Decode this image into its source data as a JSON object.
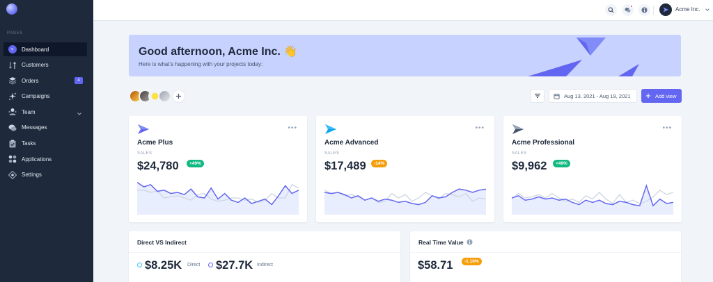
{
  "sidebar": {
    "section_label": "Pages",
    "items": [
      {
        "label": "Dashboard",
        "icon": "dashboard-icon",
        "active": true
      },
      {
        "label": "Customers",
        "icon": "customers-icon"
      },
      {
        "label": "Orders",
        "icon": "orders-icon",
        "badge": "4"
      },
      {
        "label": "Campaigns",
        "icon": "campaigns-icon"
      },
      {
        "label": "Team",
        "icon": "team-icon",
        "expandable": true
      },
      {
        "label": "Messages",
        "icon": "messages-icon"
      },
      {
        "label": "Tasks",
        "icon": "tasks-icon"
      },
      {
        "label": "Applications",
        "icon": "applications-icon"
      },
      {
        "label": "Settings",
        "icon": "settings-icon"
      }
    ]
  },
  "header": {
    "user_name": "Acme Inc."
  },
  "banner": {
    "title": "Good afternoon, Acme Inc. 👋",
    "subtitle": "Here is what’s happening with your projects today:"
  },
  "toolbar": {
    "date_range": "Aug 13, 2021 - Aug 19, 2021",
    "add_view_label": "Add view"
  },
  "kpis": [
    {
      "name": "Acme Plus",
      "label": "SALES",
      "value": "$24,780",
      "badge": "+49%",
      "badge_color": "#10b981",
      "icon_color": "#6366f1",
      "current": [
        58,
        50,
        54,
        42,
        44,
        38,
        40,
        36,
        46,
        32,
        30,
        48,
        28,
        38,
        26,
        22,
        30,
        20,
        24,
        28,
        18,
        34,
        52,
        38,
        44
      ],
      "previous": [
        44,
        44,
        40,
        42,
        30,
        32,
        34,
        30,
        26,
        36,
        38,
        28,
        24,
        26,
        30,
        30,
        26,
        28,
        22,
        26,
        38,
        30,
        30,
        54,
        48
      ]
    },
    {
      "name": "Acme Advanced",
      "label": "SALES",
      "value": "$17,489",
      "badge": "-14%",
      "badge_color": "#f59e0b",
      "icon_color": "#0ea5e9",
      "current": [
        40,
        38,
        40,
        36,
        30,
        34,
        26,
        30,
        24,
        28,
        26,
        22,
        24,
        20,
        18,
        22,
        34,
        30,
        32,
        40,
        46,
        44,
        40,
        44,
        46
      ],
      "previous": [
        44,
        38,
        40,
        34,
        36,
        32,
        26,
        30,
        22,
        24,
        38,
        30,
        36,
        24,
        30,
        40,
        34,
        28,
        38,
        36,
        32,
        38,
        24,
        30,
        28
      ]
    },
    {
      "name": "Acme Professional",
      "label": "SALES",
      "value": "$9,962",
      "badge": "+49%",
      "badge_color": "#10b981",
      "icon_color": "#475569",
      "current": [
        30,
        34,
        26,
        28,
        32,
        28,
        30,
        26,
        28,
        22,
        18,
        26,
        22,
        26,
        20,
        18,
        24,
        22,
        18,
        16,
        52,
        16,
        28,
        20,
        22
      ],
      "previous": [
        28,
        38,
        30,
        32,
        36,
        30,
        38,
        30,
        24,
        28,
        22,
        34,
        28,
        40,
        28,
        20,
        36,
        22,
        26,
        20,
        24,
        32,
        44,
        36,
        40
      ]
    }
  ],
  "direct_indirect": {
    "title": "Direct VS Indirect",
    "direct_value": "$8.25K",
    "direct_label": "Direct",
    "indirect_value": "$27.7K",
    "indirect_label": "Indirect",
    "direct_color": "#38bdf8",
    "indirect_color": "#6366f1"
  },
  "realtime": {
    "title": "Real Time Value",
    "value": "$58.71",
    "badge": "-1.10%",
    "badge_color": "#f59e0b"
  }
}
